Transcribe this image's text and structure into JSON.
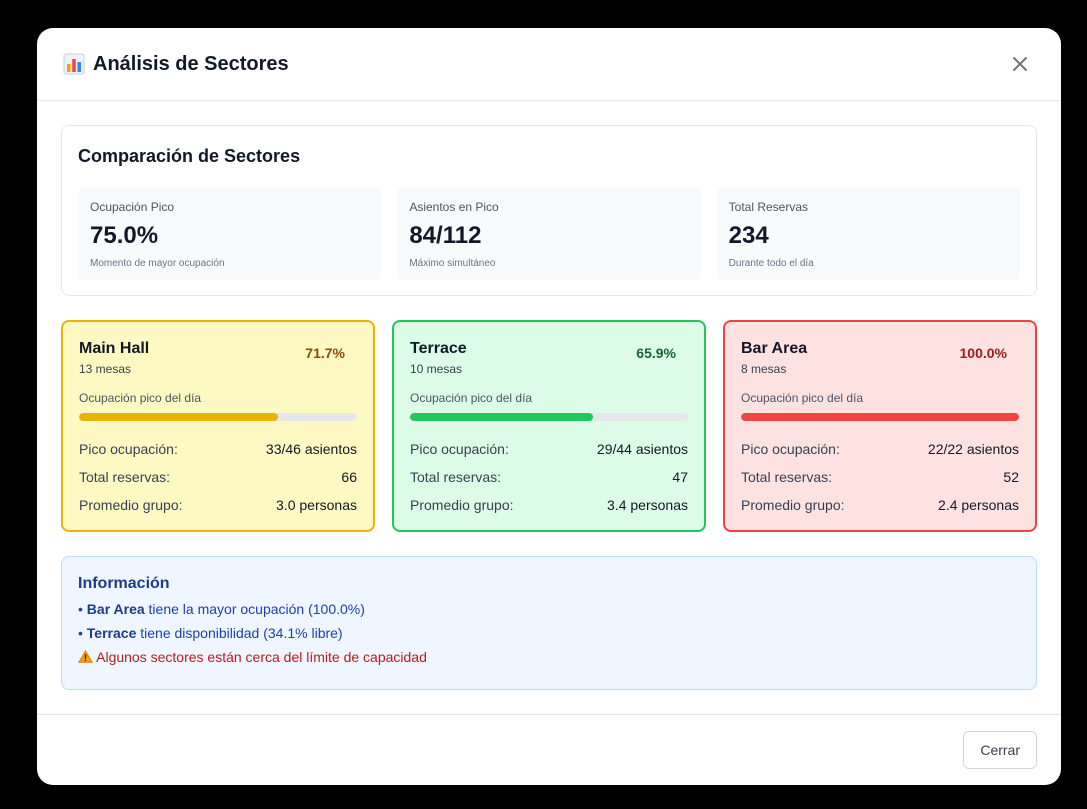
{
  "modal": {
    "title": "Análisis de Sectores",
    "title_icon": "bar-chart-icon",
    "close_icon": "close-icon"
  },
  "comparison": {
    "title": "Comparación de Sectores",
    "stats": [
      {
        "label": "Ocupación Pico",
        "value": "75.0%",
        "note": "Momento de mayor ocupación"
      },
      {
        "label": "Asientos en Pico",
        "value": "84/112",
        "note": "Máximo simultáneo"
      },
      {
        "label": "Total Reservas",
        "value": "234",
        "note": "Durante todo el día"
      }
    ]
  },
  "sectors": [
    {
      "name": "Main Hall",
      "tables": "13 mesas",
      "pct": "71.7%",
      "occupancy": 0.717,
      "occ_label": "Ocupación pico del día",
      "rows": [
        {
          "key": "Pico ocupación:",
          "val": "33/46 asientos"
        },
        {
          "key": "Total reservas:",
          "val": "66"
        },
        {
          "key": "Promedio grupo:",
          "val": "3.0 personas"
        }
      ],
      "color": "#eab308"
    },
    {
      "name": "Terrace",
      "tables": "10 mesas",
      "pct": "65.9%",
      "occupancy": 0.659,
      "occ_label": "Ocupación pico del día",
      "rows": [
        {
          "key": "Pico ocupación:",
          "val": "29/44 asientos"
        },
        {
          "key": "Total reservas:",
          "val": "47"
        },
        {
          "key": "Promedio grupo:",
          "val": "3.4 personas"
        }
      ],
      "color": "#22c55e"
    },
    {
      "name": "Bar Area",
      "tables": "8 mesas",
      "pct": "100.0%",
      "occupancy": 1.0,
      "occ_label": "Ocupación pico del día",
      "rows": [
        {
          "key": "Pico ocupación:",
          "val": "22/22 asientos"
        },
        {
          "key": "Total reservas:",
          "val": "52"
        },
        {
          "key": "Promedio grupo:",
          "val": "2.4 personas"
        }
      ],
      "color": "#ef4444"
    }
  ],
  "info": {
    "title": "Información",
    "line1_bullet": "•",
    "line1_bold": "Bar Area",
    "line1_rest": " tiene la mayor ocupación (100.0%)",
    "line2_bullet": "•",
    "line2_bold": "Terrace",
    "line2_rest": " tiene disponibilidad (34.1% libre)",
    "warning_icon": "warning-icon",
    "warning_text": "Algunos sectores están cerca del límite de capacidad"
  },
  "footer": {
    "close_label": "Cerrar"
  }
}
